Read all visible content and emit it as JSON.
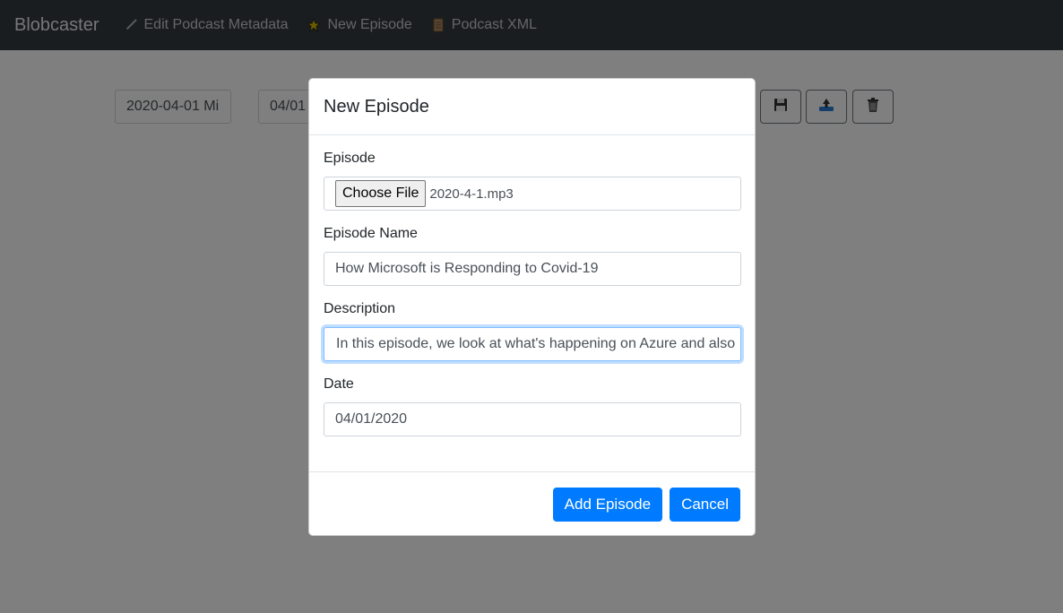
{
  "navbar": {
    "brand": "Blobcaster",
    "links": [
      {
        "label": "Edit Podcast Metadata",
        "icon": "pencil-icon"
      },
      {
        "label": "New Episode",
        "icon": "star-icon"
      },
      {
        "label": "Podcast XML",
        "icon": "scroll-icon"
      }
    ]
  },
  "background": {
    "episode_field": "2020-04-01 Mi",
    "date_field": "04/01",
    "buttons": [
      "floppy-disk-icon",
      "upload-icon",
      "trash-icon"
    ]
  },
  "modal": {
    "title": "New Episode",
    "episode": {
      "label": "Episode",
      "choose_button": "Choose File",
      "file_name": "2020-4-1.mp3"
    },
    "episode_name": {
      "label": "Episode Name",
      "value": "How Microsoft is Responding to Covid-19"
    },
    "description": {
      "label": "Description",
      "value": "In this episode, we look at what's happening on Azure and also"
    },
    "date": {
      "label": "Date",
      "value": "04/01/2020"
    },
    "add_button": "Add Episode",
    "cancel_button": "Cancel"
  },
  "colors": {
    "navbar": "#343a40",
    "primary": "#007bff",
    "focus_border": "#80bdff"
  }
}
